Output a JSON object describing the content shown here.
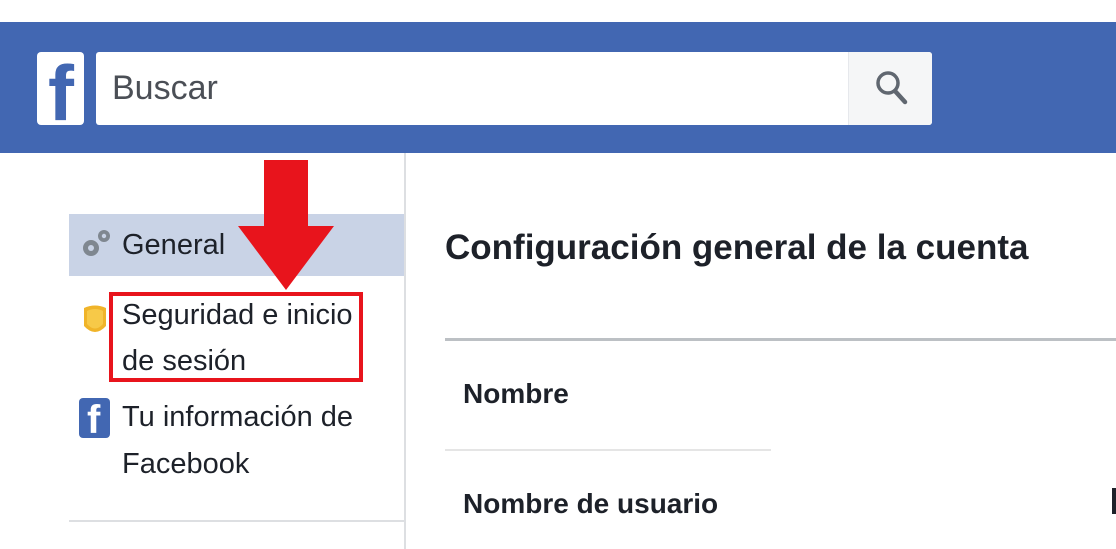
{
  "header": {
    "logo_letter": "f",
    "search_placeholder": "Buscar"
  },
  "sidebar": {
    "items": [
      {
        "label": "General",
        "icon": "gears-icon",
        "selected": true
      },
      {
        "label": "Seguridad e inicio de sesión",
        "icon": "security-badge-icon",
        "highlighted": true
      },
      {
        "label": "Tu información de Facebook",
        "icon": "facebook-icon"
      }
    ]
  },
  "main": {
    "title": "Configuración general de la cuenta",
    "rows": [
      {
        "label": "Nombre"
      },
      {
        "label": "Nombre de usuario"
      }
    ]
  },
  "colors": {
    "brand_blue": "#4267b2",
    "selected_bg": "#c9d3e6",
    "annotation_red": "#e8141c"
  }
}
